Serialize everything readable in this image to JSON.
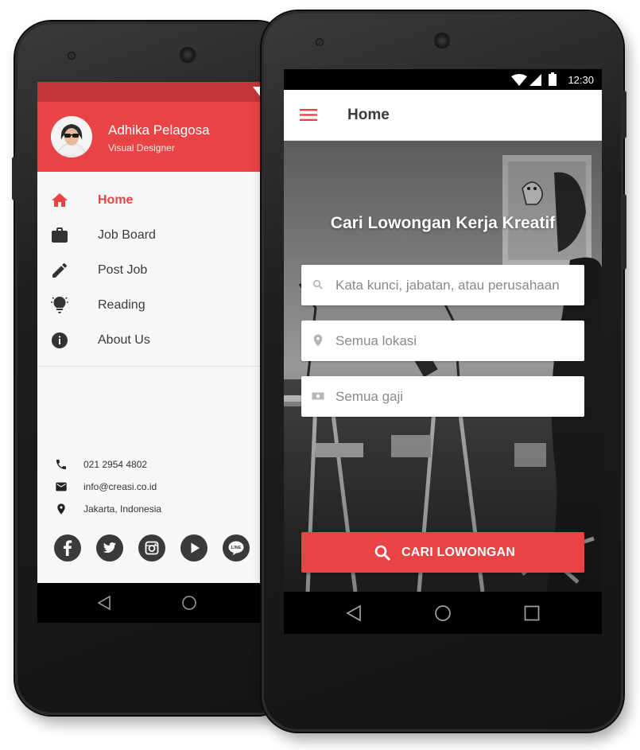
{
  "left_phone": {
    "drawer": {
      "user": {
        "name": "Adhika Pelagosa",
        "role": "Visual Designer"
      },
      "menu": [
        {
          "label": "Home",
          "icon": "home-icon",
          "active": true
        },
        {
          "label": "Job Board",
          "icon": "briefcase-icon",
          "active": false
        },
        {
          "label": "Post Job",
          "icon": "pencil-icon",
          "active": false
        },
        {
          "label": "Reading",
          "icon": "lightbulb-icon",
          "active": false
        },
        {
          "label": "About Us",
          "icon": "info-icon",
          "active": false
        }
      ],
      "contacts": [
        {
          "icon": "phone-icon",
          "text": "021 2954 4802"
        },
        {
          "icon": "email-icon",
          "text": "info@creasi.co.id"
        },
        {
          "icon": "location-pin-icon",
          "text": "Jakarta, Indonesia"
        }
      ],
      "social": [
        "facebook-icon",
        "twitter-icon",
        "instagram-icon",
        "youtube-icon",
        "line-icon"
      ],
      "social_line_text": "LINE"
    }
  },
  "right_phone": {
    "status": {
      "time": "12:30"
    },
    "app_bar": {
      "title": "Home"
    },
    "hero": {
      "title": "Cari Lowongan Kerja Kreatif",
      "keyword_placeholder": "Kata kunci, jabatan, atau perusahaan",
      "location_placeholder": "Semua lokasi",
      "salary_placeholder": "Semua gaji",
      "search_button": "CARI LOWONGAN"
    }
  },
  "colors": {
    "accent": "#e84345",
    "accent_dark": "#c4353a",
    "icon_dark": "#333333"
  }
}
